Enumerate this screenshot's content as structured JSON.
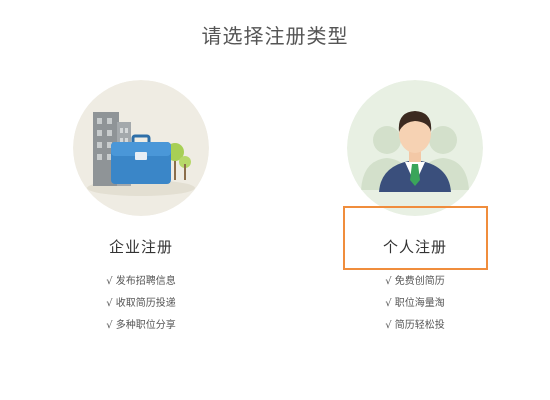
{
  "page": {
    "title": "请选择注册类型"
  },
  "options": [
    {
      "label": "企业注册",
      "features": [
        "√ 发布招聘信息",
        "√ 收取简历投递",
        "√ 多种职位分享"
      ]
    },
    {
      "label": "个人注册",
      "features": [
        "√ 免费创简历",
        "√ 职位海量淘",
        "√ 简历轻松投"
      ]
    }
  ],
  "colors": {
    "highlight_border": "#f08d3c",
    "enterprise_circle": "#efece3",
    "personal_circle": "#e8f0e3",
    "briefcase": "#3a86c8",
    "suit": "#3a4f7c",
    "tie": "#3aa55a"
  },
  "icons": {
    "enterprise": "building-briefcase-icon",
    "personal": "businessman-avatar-icon"
  }
}
